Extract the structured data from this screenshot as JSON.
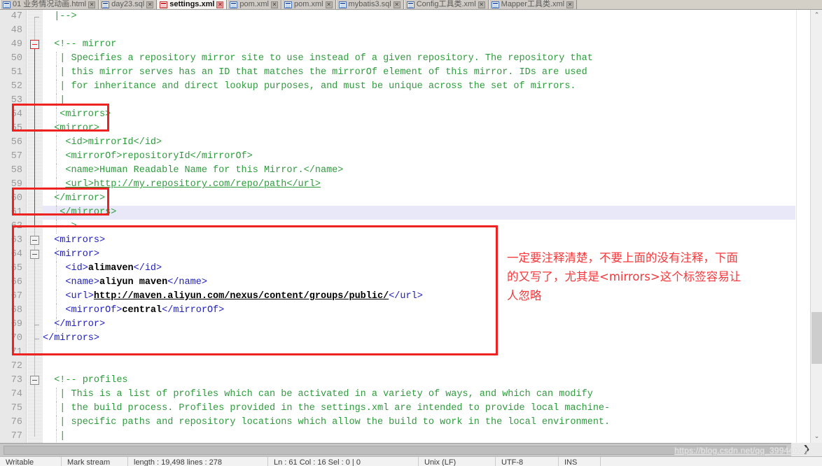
{
  "window": {
    "app": "xml-editor",
    "active_file": "settings.xml"
  },
  "tabs": [
    {
      "label": "01 业务情况动画.html",
      "icon": "html-file-icon",
      "close": "✕",
      "active": false
    },
    {
      "label": "day23.sql",
      "icon": "sql-file-icon",
      "close": "✕",
      "active": false
    },
    {
      "label": "settings.xml",
      "icon": "xml-file-icon",
      "close": "✕",
      "active": true
    },
    {
      "label": "pom.xml",
      "icon": "xml-file-icon",
      "close": "✕",
      "active": false
    },
    {
      "label": "pom.xml",
      "icon": "xml-file-icon",
      "close": "✕",
      "active": false
    },
    {
      "label": "mybatis3.sql",
      "icon": "sql-file-icon",
      "close": "✕",
      "active": false
    },
    {
      "label": "Config工具类.xml",
      "icon": "xml-file-icon",
      "close": "✕",
      "active": false
    },
    {
      "label": "Mapper工具类.xml",
      "icon": "xml-file-icon",
      "close": "✕",
      "active": false
    }
  ],
  "editor": {
    "first_line": 47,
    "current_line": 61,
    "lines": [
      {
        "n": 47,
        "tokens": [
          {
            "t": "  |-->",
            "c": "cmt"
          }
        ]
      },
      {
        "n": 48,
        "tokens": []
      },
      {
        "n": 49,
        "tokens": [
          {
            "t": "  <!-- mirror",
            "c": "cmt"
          }
        ]
      },
      {
        "n": 50,
        "tokens": [
          {
            "t": "   | Specifies a repository mirror site to use instead of a given repository. The repository that",
            "c": "cmt"
          }
        ]
      },
      {
        "n": 51,
        "tokens": [
          {
            "t": "   | this mirror serves has an ID that matches the mirrorOf element of this mirror. IDs are used",
            "c": "cmt"
          }
        ]
      },
      {
        "n": 52,
        "tokens": [
          {
            "t": "   | for inheritance and direct lookup purposes, and must be unique across the set of mirrors.",
            "c": "cmt"
          }
        ]
      },
      {
        "n": 53,
        "tokens": [
          {
            "t": "   |",
            "c": "cmt"
          }
        ]
      },
      {
        "n": 54,
        "tokens": [
          {
            "t": "   <mirrors>",
            "c": "cmt"
          }
        ]
      },
      {
        "n": 55,
        "tokens": [
          {
            "t": "  <mirror>",
            "c": "cmt"
          }
        ]
      },
      {
        "n": 56,
        "tokens": [
          {
            "t": "    <id>mirrorId</id>",
            "c": "cmt"
          }
        ]
      },
      {
        "n": 57,
        "tokens": [
          {
            "t": "    <mirrorOf>repositoryId</mirrorOf>",
            "c": "cmt"
          }
        ]
      },
      {
        "n": 58,
        "tokens": [
          {
            "t": "    <name>Human Readable Name for this Mirror.</name>",
            "c": "cmt"
          }
        ]
      },
      {
        "n": 59,
        "tokens": [
          {
            "t": "    ",
            "c": "cmt"
          },
          {
            "t": "<url>http://my.repository.com/repo/path</url>",
            "c": "cmt-u"
          }
        ]
      },
      {
        "n": 60,
        "tokens": [
          {
            "t": "  </mirror>",
            "c": "cmt"
          }
        ]
      },
      {
        "n": 61,
        "tokens": [
          {
            "t": "   </mirrors>",
            "c": "cmt"
          }
        ]
      },
      {
        "n": 62,
        "tokens": [
          {
            "t": "   -->",
            "c": "cmt"
          }
        ]
      },
      {
        "n": 63,
        "tokens": [
          {
            "t": "  <mirrors>",
            "c": "tag"
          }
        ]
      },
      {
        "n": 64,
        "tokens": [
          {
            "t": "  <mirror>",
            "c": "tag"
          }
        ]
      },
      {
        "n": 65,
        "tokens": [
          {
            "t": "    <id>",
            "c": "tag"
          },
          {
            "t": "alimaven",
            "c": "txt"
          },
          {
            "t": "</id>",
            "c": "tag"
          }
        ]
      },
      {
        "n": 66,
        "tokens": [
          {
            "t": "    <name>",
            "c": "tag"
          },
          {
            "t": "aliyun maven",
            "c": "txt"
          },
          {
            "t": "</name>",
            "c": "tag"
          }
        ]
      },
      {
        "n": 67,
        "tokens": [
          {
            "t": "    <url>",
            "c": "tag"
          },
          {
            "t": "http://maven.aliyun.com/nexus/content/groups/public/",
            "c": "txt-u"
          },
          {
            "t": "</url>",
            "c": "tag"
          }
        ]
      },
      {
        "n": 68,
        "tokens": [
          {
            "t": "    <mirrorOf>",
            "c": "tag"
          },
          {
            "t": "central",
            "c": "txt"
          },
          {
            "t": "</mirrorOf>",
            "c": "tag"
          }
        ]
      },
      {
        "n": 69,
        "tokens": [
          {
            "t": "  </mirror>",
            "c": "tag"
          }
        ]
      },
      {
        "n": 70,
        "tokens": [
          {
            "t": "</mirrors>",
            "c": "tag"
          }
        ]
      },
      {
        "n": 71,
        "tokens": []
      },
      {
        "n": 72,
        "tokens": []
      },
      {
        "n": 73,
        "tokens": [
          {
            "t": "  <!-- profiles",
            "c": "cmt"
          }
        ]
      },
      {
        "n": 74,
        "tokens": [
          {
            "t": "   | This is a list of profiles which can be activated in a variety of ways, and which can modify",
            "c": "cmt"
          }
        ]
      },
      {
        "n": 75,
        "tokens": [
          {
            "t": "   | the build process. Profiles provided in the settings.xml are intended to provide local machine-",
            "c": "cmt"
          }
        ]
      },
      {
        "n": 76,
        "tokens": [
          {
            "t": "   | specific paths and repository locations which allow the build to work in the local environment.",
            "c": "cmt"
          }
        ]
      },
      {
        "n": 77,
        "tokens": [
          {
            "t": "   |",
            "c": "cmt"
          }
        ]
      }
    ]
  },
  "annotation": {
    "text": "一定要注释清楚，不要上面的没有注释，下面的又写了，尤其是<mirrors>这个标签容易让人忽略",
    "color": "#f5383b"
  },
  "highlights": [
    {
      "name": "mirrors-open-commented",
      "label": "red-box-around-commented-mirrors-open"
    },
    {
      "name": "mirrors-close-commented",
      "label": "red-box-around-commented-mirrors-close"
    },
    {
      "name": "active-mirrors-block",
      "label": "red-box-around-active-mirrors-block"
    }
  ],
  "scrollbar": {
    "up_arrow": "⌃",
    "down_arrow": "⌄"
  },
  "watermark": {
    "text": "https://blog.csdn.net/qq_39944028"
  },
  "bottom_corner": {
    "glyph": "❯"
  },
  "statusbar": {
    "cells": [
      "Writable",
      "Mark stream",
      "length : 19,498   lines : 278",
      "Ln : 61   Col : 16   Sel : 0 | 0",
      "Unix (LF)",
      "UTF-8",
      "INS"
    ]
  },
  "colors": {
    "comment": "#2e9b3c",
    "tag": "#2020c0",
    "text": "#000000",
    "annotation": "#f5383b",
    "box": "#ef2222",
    "current_line": "#e8e8f8",
    "gutter": "#e8e8e8"
  }
}
